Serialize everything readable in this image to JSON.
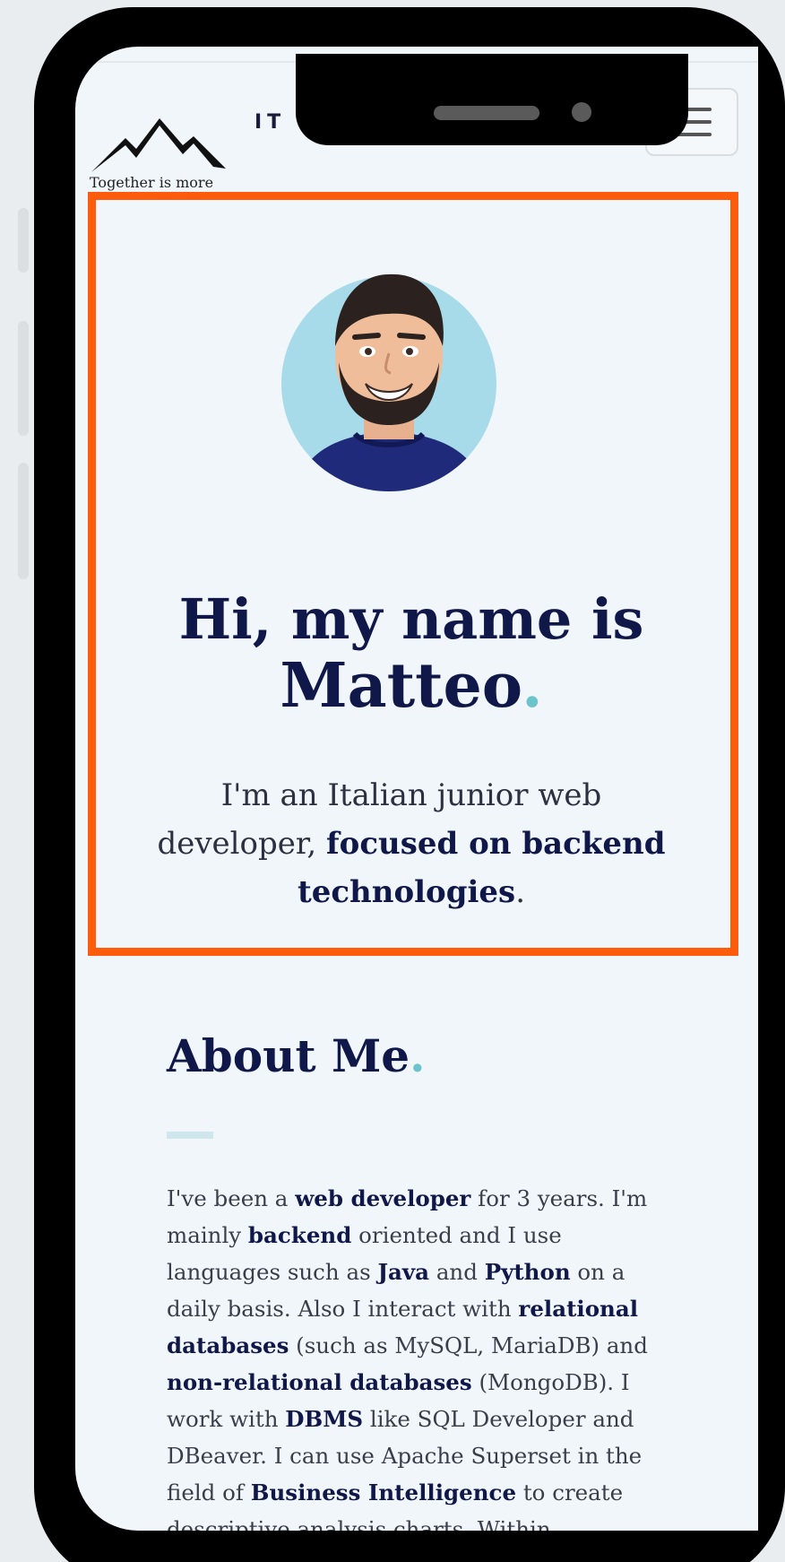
{
  "header": {
    "logo_tagline": "Together is more",
    "brand": "IT",
    "menu_icon": "hamburger-icon"
  },
  "hero": {
    "avatar": "cartoon portrait of a smiling man with beard",
    "title_line": "Hi, my name is",
    "name": "Matteo",
    "name_dot": ".",
    "sub_1": "I'm an Italian junior web developer, ",
    "sub_bold": "focused on backend technologies",
    "sub_end": "."
  },
  "about": {
    "title": "About Me",
    "title_dot": ".",
    "p": {
      "t1": "I've been a ",
      "b1": "web developer",
      "t2": " for 3 years. I'm mainly ",
      "b2": "backend",
      "t3": " oriented and I use languages such as ",
      "b3": "Java",
      "t4": " and ",
      "b4": "Python",
      "t5": " on a daily basis. Also I interact with ",
      "b5": "relational databases",
      "t6": " (such as MySQL, MariaDB) and ",
      "b6": "non-relational databases",
      "t7": " (MongoDB). I work with ",
      "b7": "DBMS",
      "t8": " like SQL Developer and DBeaver. I can use Apache Superset in the field of ",
      "b8": "Business Intelligence",
      "t9": " to create descriptive analysis charts. Within"
    }
  },
  "colors": {
    "accent_frame": "#ff5b0d",
    "navy_text": "#10184a",
    "teal_dot": "#6cc3cc",
    "page_bg": "#f1f6fa"
  }
}
